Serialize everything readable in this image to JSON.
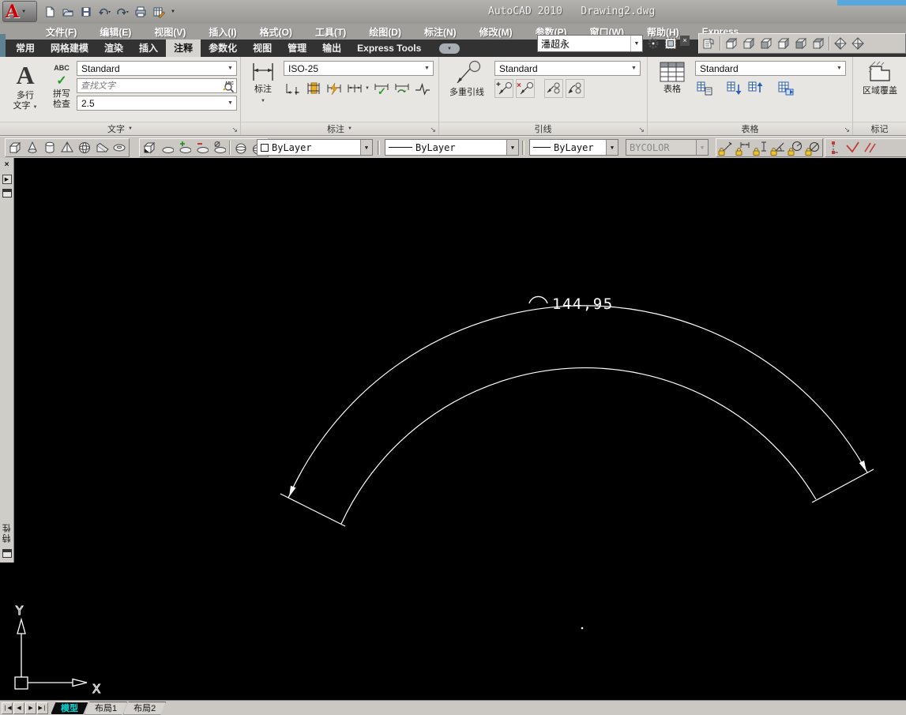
{
  "window": {
    "title": "AutoCAD 2010   Drawing2.dwg"
  },
  "menu": {
    "items": [
      "文件(F)",
      "编辑(E)",
      "视图(V)",
      "插入(I)",
      "格式(O)",
      "工具(T)",
      "绘图(D)",
      "标注(N)",
      "修改(M)",
      "参数(P)",
      "窗口(W)",
      "帮助(H)",
      "Express"
    ]
  },
  "ribbon": {
    "tabs": [
      "常用",
      "网格建模",
      "渲染",
      "插入",
      "注释",
      "参数化",
      "视图",
      "管理",
      "输出",
      "Express Tools"
    ],
    "active_tab": "注释"
  },
  "panels": {
    "text": {
      "title": "文字",
      "mtext": [
        "多行",
        "文字"
      ],
      "spell": [
        "拼写",
        "检查"
      ],
      "style_value": "Standard",
      "find_placeholder": "查找文字",
      "height_value": "2.5"
    },
    "dimension": {
      "title": "标注",
      "button_label": "标注",
      "style_value": "ISO-25"
    },
    "leader": {
      "title": "引线",
      "button_label": "多重引线",
      "style_value": "Standard"
    },
    "table": {
      "title": "表格",
      "button_label": "表格",
      "style_value": "Standard"
    },
    "markup": {
      "title": "标记",
      "wipeout_label": "区域覆盖"
    }
  },
  "infocenter": {
    "search_value": "潘超永"
  },
  "properties_toolbar": {
    "color": "ByLayer",
    "linetype": "ByLayer",
    "lineweight": "ByLayer",
    "plot_style": "BYCOLOR"
  },
  "canvas": {
    "dimension_text": "144,95",
    "ucs_x_label": "X",
    "ucs_y_label": "Y"
  },
  "palette": {
    "title": "特性"
  },
  "layout_tabs": {
    "model": "模型",
    "layout1": "布局1",
    "layout2": "布局2"
  },
  "colors": {
    "canvas_bg": "#000000",
    "line": "#ffffff",
    "model_tab_text": "#00d9d9",
    "title_strip_blue": "#58a8dc",
    "lock_yellow": "#f2c12e"
  }
}
